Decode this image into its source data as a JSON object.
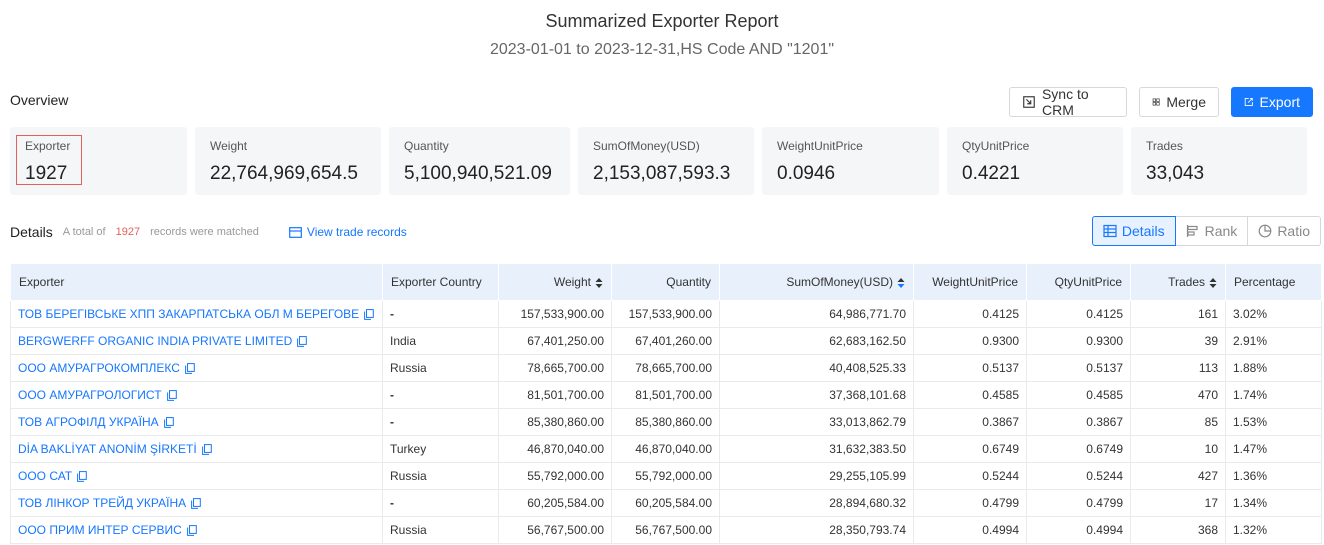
{
  "header": {
    "title": "Summarized Exporter Report",
    "subtitle": "2023-01-01 to 2023-12-31,HS Code AND \"1201\""
  },
  "overview": {
    "label": "Overview",
    "buttons": {
      "sync": "Sync to CRM",
      "merge": "Merge",
      "export": "Export"
    },
    "cards": [
      {
        "label": "Exporter",
        "value": "1927"
      },
      {
        "label": "Weight",
        "value": "22,764,969,654.5"
      },
      {
        "label": "Quantity",
        "value": "5,100,940,521.09"
      },
      {
        "label": "SumOfMoney(USD)",
        "value": "2,153,087,593.3"
      },
      {
        "label": "WeightUnitPrice",
        "value": "0.0946"
      },
      {
        "label": "QtyUnitPrice",
        "value": "0.4221"
      },
      {
        "label": "Trades",
        "value": "33,043"
      }
    ]
  },
  "details": {
    "label": "Details",
    "info_prefix": "A total of",
    "count": "1927",
    "info_suffix": "records were matched",
    "view_link": "View trade records",
    "tabs": [
      "Details",
      "Rank",
      "Ratio"
    ]
  },
  "table": {
    "columns": [
      "Exporter",
      "Exporter Country",
      "Weight",
      "Quantity",
      "SumOfMoney(USD)",
      "WeightUnitPrice",
      "QtyUnitPrice",
      "Trades",
      "Percentage"
    ],
    "rows": [
      [
        "ТОВ БЕРЕГІВСЬКЕ ХПП ЗАКАРПАТСЬКА ОБЛ М БЕРЕГОВЕ",
        "-",
        "157,533,900.00",
        "157,533,900.00",
        "64,986,771.70",
        "0.4125",
        "0.4125",
        "161",
        "3.02%"
      ],
      [
        "BERGWERFF ORGANIC INDIA PRIVATE LIMITED",
        "India",
        "67,401,250.00",
        "67,401,260.00",
        "62,683,162.50",
        "0.9300",
        "0.9300",
        "39",
        "2.91%"
      ],
      [
        "ООО АМУРАГРОКОМПЛЕКС",
        "Russia",
        "78,665,700.00",
        "78,665,700.00",
        "40,408,525.33",
        "0.5137",
        "0.5137",
        "113",
        "1.88%"
      ],
      [
        "ООО АМУРАГРОЛОГИСТ",
        "-",
        "81,501,700.00",
        "81,501,700.00",
        "37,368,101.68",
        "0.4585",
        "0.4585",
        "470",
        "1.74%"
      ],
      [
        "ТОВ АГРОФІЛД УКРАЇНА",
        "-",
        "85,380,860.00",
        "85,380,860.00",
        "33,013,862.79",
        "0.3867",
        "0.3867",
        "85",
        "1.53%"
      ],
      [
        "DİA BAKLİYAT ANONİM ŞİRKETİ",
        "Turkey",
        "46,870,040.00",
        "46,870,040.00",
        "31,632,383.50",
        "0.6749",
        "0.6749",
        "10",
        "1.47%"
      ],
      [
        "ООО САТ",
        "Russia",
        "55,792,000.00",
        "55,792,000.00",
        "29,255,105.99",
        "0.5244",
        "0.5244",
        "427",
        "1.36%"
      ],
      [
        "ТОВ ЛІНКОР ТРЕЙД УКРАЇНА",
        "-",
        "60,205,584.00",
        "60,205,584.00",
        "28,894,680.32",
        "0.4799",
        "0.4799",
        "17",
        "1.34%"
      ],
      [
        "ООО ПРИМ ИНТЕР СЕРВИС",
        "Russia",
        "56,767,500.00",
        "56,767,500.00",
        "28,350,793.74",
        "0.4994",
        "0.4994",
        "368",
        "1.32%"
      ]
    ]
  }
}
